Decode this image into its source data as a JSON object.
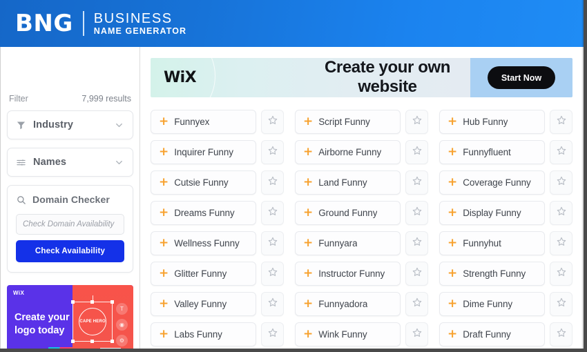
{
  "header": {
    "logo_mark": "BNG",
    "brand_line1": "BUSINESS",
    "brand_line2": "NAME GENERATOR"
  },
  "sidebar": {
    "filter_label": "Filter",
    "results_count": "7,999 results",
    "filters": [
      {
        "label": "Industry",
        "icon": "funnel-icon"
      },
      {
        "label": "Names",
        "icon": "sliders-icon"
      }
    ],
    "domain_checker": {
      "title": "Domain Checker",
      "icon": "search-icon",
      "input_value": "",
      "input_placeholder": "Check Domain Availability",
      "button_label": "Check Availability",
      "button_color": "#1431e8"
    },
    "logo_ad": {
      "brand": "WiX",
      "headline_line1": "Create your",
      "headline_line2": "logo today",
      "canvas_text": "CAPE HERO",
      "left_color": "#5a32e8",
      "right_color": "#f8534a"
    }
  },
  "banner": {
    "brand": "WiX",
    "headline": "Create your own  website",
    "cta_label": "Start Now",
    "cta_bg": "#a9d0f3",
    "cta_button_color": "#0c0d10"
  },
  "results": {
    "plus_icon_color": "#f7a12d",
    "star_icon": "star-outline-icon",
    "add_icon": "plus-icon",
    "names": [
      "Funnyex",
      "Script Funny",
      "Hub Funny",
      "Inquirer Funny",
      "Airborne Funny",
      "Funnyfluent",
      "Cutsie Funny",
      "Land Funny",
      "Coverage Funny",
      "Dreams Funny",
      "Ground Funny",
      "Display Funny",
      "Wellness Funny",
      "Funnyara",
      "Funnyhut",
      "Glitter Funny",
      "Instructor Funny",
      "Strength Funny",
      "Valley Funny",
      "Funnyadora",
      "Dime Funny",
      "Labs Funny",
      "Wink Funny",
      "Draft Funny"
    ]
  }
}
